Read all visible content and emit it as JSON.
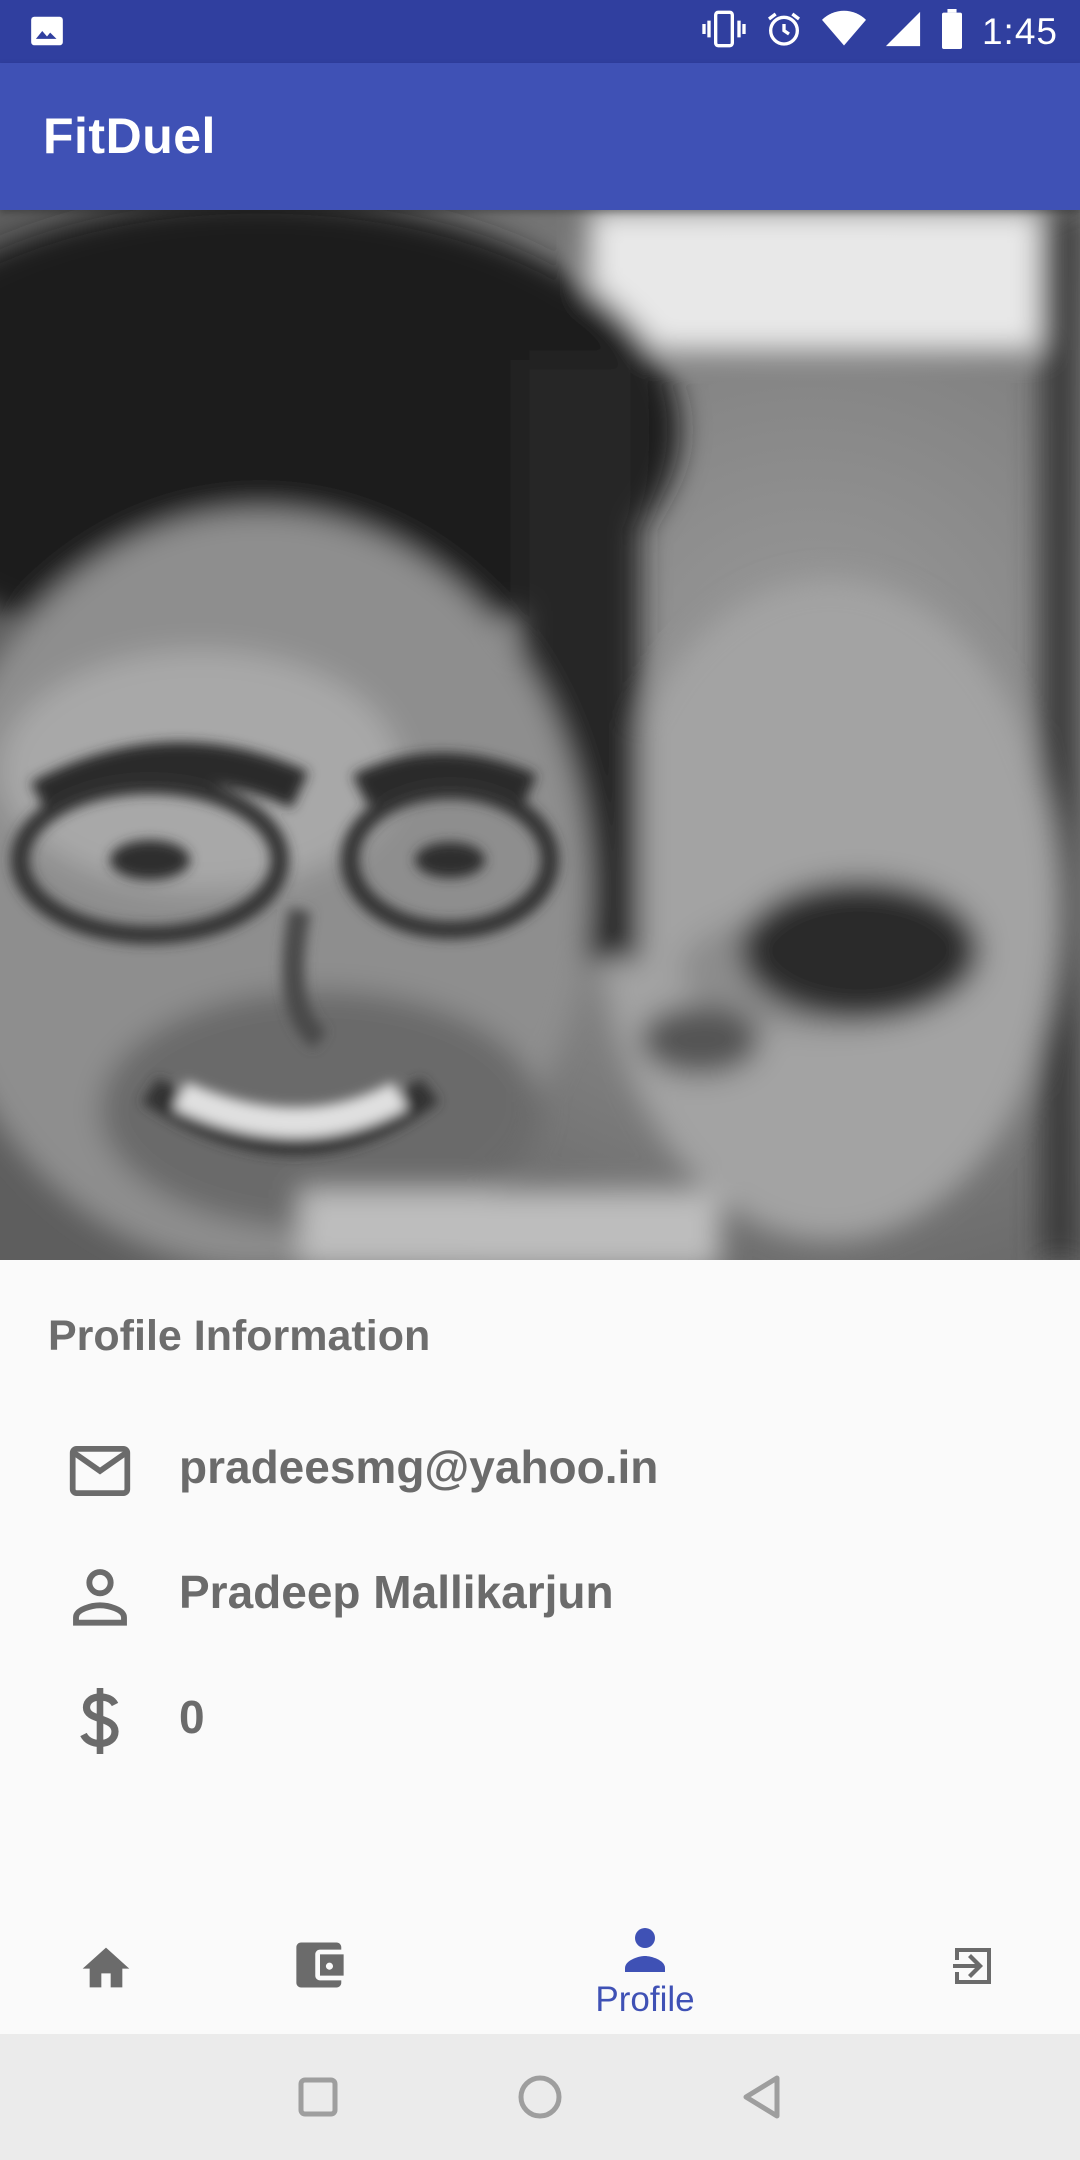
{
  "status_bar": {
    "time": "1:45",
    "icons": [
      "image-notification-icon",
      "vibrate-icon",
      "alarm-icon",
      "wifi-icon",
      "cell-signal-icon",
      "battery-icon"
    ]
  },
  "app_bar": {
    "title": "FitDuel"
  },
  "profile_photo": {
    "icon": "profile-photo"
  },
  "profile_info": {
    "heading": "Profile Information",
    "email": "pradeesmg@yahoo.in",
    "name": "Pradeep Mallikarjun",
    "balance": "0"
  },
  "bottom_nav": {
    "items": [
      {
        "icon": "home-icon",
        "label": ""
      },
      {
        "icon": "wallet-icon",
        "label": ""
      },
      {
        "icon": "person-icon",
        "label": "Profile",
        "active": true
      },
      {
        "icon": "logout-icon",
        "label": ""
      }
    ]
  },
  "system_nav": {
    "buttons": [
      "recents-icon",
      "home-circle-icon",
      "back-icon"
    ]
  },
  "colors": {
    "primary": "#3f51b5",
    "primary_dark": "#303f9f",
    "text_grey": "#6b6b6b",
    "background": "#fafafa"
  }
}
